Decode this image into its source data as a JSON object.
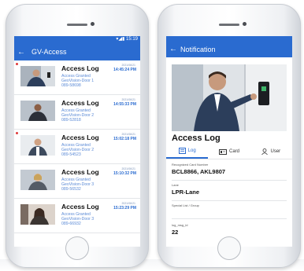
{
  "left_phone": {
    "status_time": "15:19",
    "app_title": "GV-Access",
    "items": [
      {
        "title": "Access Log",
        "line1": "Access Granted",
        "line2": "GeoVision-Door 1",
        "line3": "089-58698",
        "date": "2021/06/21",
        "time": "14:45:24 PM",
        "unread": true
      },
      {
        "title": "Access Log",
        "line1": "Access Granted",
        "line2": "GeoVision-Door 2",
        "line3": "089-52818",
        "date": "2021/06/21",
        "time": "14:55:33 PM",
        "unread": false
      },
      {
        "title": "Access Log",
        "line1": "Access Granted",
        "line2": "GeoVision-Door 2",
        "line3": "089-54523",
        "date": "2021/06/21",
        "time": "15:02:18 PM",
        "unread": true
      },
      {
        "title": "Access Log",
        "line1": "Access Granted",
        "line2": "GeoVision-Door 3",
        "line3": "089-56532",
        "date": "2021/06/21",
        "time": "15:10:32 PM",
        "unread": false
      },
      {
        "title": "Access Log",
        "line1": "Access Granted",
        "line2": "GeoVision-Door 3",
        "line3": "089-66932",
        "date": "2021/06/21",
        "time": "15:23:29 PM",
        "unread": false
      }
    ]
  },
  "right_phone": {
    "app_title": "Notification",
    "detail_title": "Access Log",
    "tabs": [
      {
        "label": "Log",
        "icon": "log-icon"
      },
      {
        "label": "Card",
        "icon": "card-icon"
      },
      {
        "label": "User",
        "icon": "user-icon"
      }
    ],
    "fields": [
      {
        "label": "Recognized Card Number",
        "value": "BCL8866, AKL9807"
      },
      {
        "label": "Lane",
        "value": "LPR-Lane"
      },
      {
        "label": "Special List / Group",
        "value": ""
      },
      {
        "label": "log_msg_id",
        "value": "22"
      }
    ]
  },
  "colors": {
    "accent": "#2a6bd0",
    "unread_dot": "#e03a3a",
    "detail_text": "#5b8ad6"
  }
}
